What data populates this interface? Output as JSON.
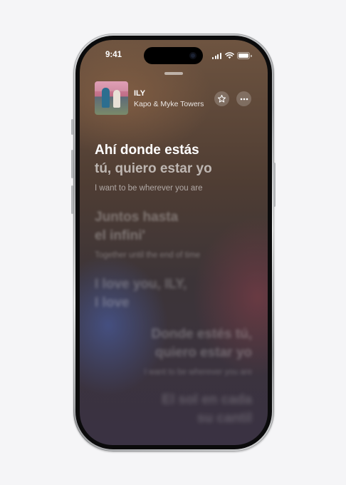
{
  "status_bar": {
    "time": "9:41"
  },
  "now_playing": {
    "title": "ILY",
    "artist": "Kapo & Myke Towers",
    "favorite_icon": "star-icon",
    "more_icon": "ellipsis-icon"
  },
  "lyrics": {
    "current": {
      "line1": "Ahí donde estás",
      "line2": "tú, quiero estar yo",
      "translation": "I want to be wherever you are"
    },
    "upcoming": [
      {
        "line1": "Juntos hasta",
        "line2": "el infini'",
        "translation": "Together until the end of time"
      },
      {
        "line1": "I love you, ILY,",
        "line2": "I love"
      },
      {
        "line1": "Donde estés tú,",
        "line2": "quiero estar yo",
        "translation": "I want to be wherever you are"
      },
      {
        "line1": "El sol en cada",
        "line2": "su cantil"
      }
    ]
  }
}
